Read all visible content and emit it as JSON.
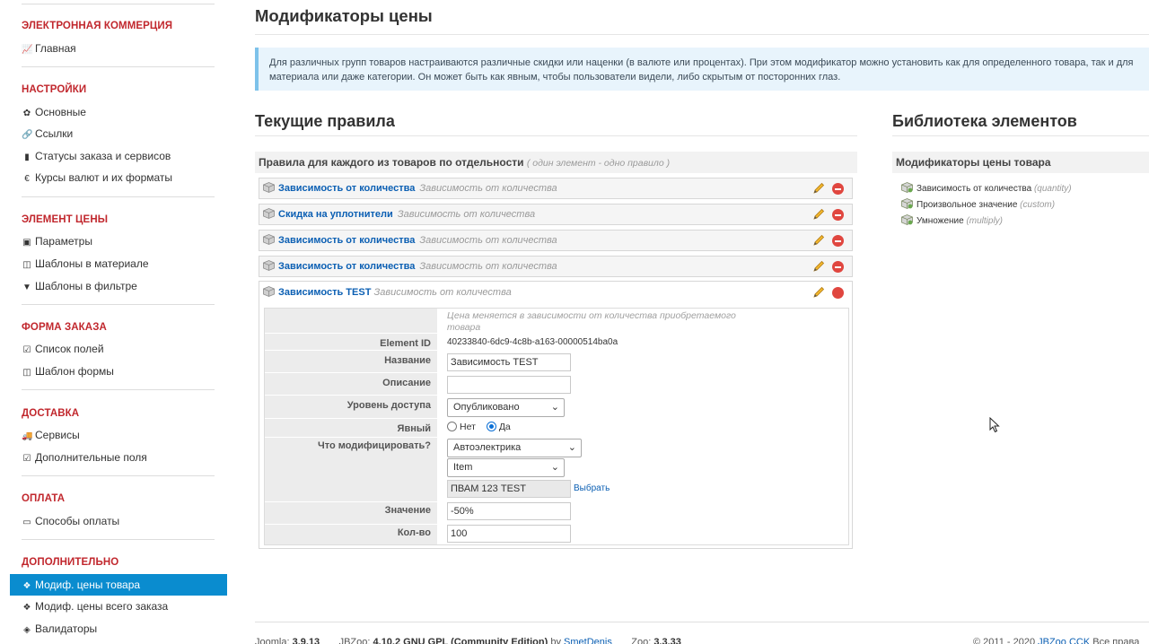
{
  "sidebar": {
    "sections": [
      {
        "title": "ЭЛЕКТРОННАЯ КОММЕРЦИЯ",
        "items": [
          {
            "label": "Главная",
            "icon": "chart-line-icon"
          }
        ]
      },
      {
        "title": "НАСТРОЙКИ",
        "items": [
          {
            "label": "Основные",
            "icon": "gear-icon"
          },
          {
            "label": "Ссылки",
            "icon": "link-icon"
          },
          {
            "label": "Статусы заказа и сервисов",
            "icon": "bookmark-icon"
          },
          {
            "label": "Курсы валют и их форматы",
            "icon": "euro-icon"
          }
        ]
      },
      {
        "title": "ЭЛЕМЕНТ ЦЕНЫ",
        "items": [
          {
            "label": "Параметры",
            "icon": "money-icon"
          },
          {
            "label": "Шаблоны в материале",
            "icon": "columns-icon"
          },
          {
            "label": "Шаблоны в фильтре",
            "icon": "filter-icon"
          }
        ]
      },
      {
        "title": "ФОРМА ЗАКАЗА",
        "items": [
          {
            "label": "Список полей",
            "icon": "checkbox-icon"
          },
          {
            "label": "Шаблон формы",
            "icon": "columns-icon"
          }
        ]
      },
      {
        "title": "ДОСТАВКА",
        "items": [
          {
            "label": "Сервисы",
            "icon": "truck-icon"
          },
          {
            "label": "Дополнительные поля",
            "icon": "checkbox-icon"
          }
        ]
      },
      {
        "title": "ОПЛАТА",
        "items": [
          {
            "label": "Способы оплаты",
            "icon": "credit-card-icon"
          }
        ]
      },
      {
        "title": "ДОПОЛНИТЕЛЬНО",
        "items": [
          {
            "label": "Модиф. цены товара",
            "icon": "cubes-icon",
            "active": true
          },
          {
            "label": "Модиф. цены всего заказа",
            "icon": "cubes-icon"
          },
          {
            "label": "Валидаторы",
            "icon": "cube-icon"
          }
        ]
      }
    ]
  },
  "page": {
    "title": "Модификаторы цены",
    "info_line1": "Для различных групп товаров настраиваются различные скидки или наценки (в валюте или процентах). При этом модификатор можно установить как для определенного товара, так и для",
    "info_line2": "материала или даже категории. Он может быть как явным, чтобы пользователи видели, либо скрытым от посторонних глаз."
  },
  "current_rules": {
    "heading": "Текущие правила",
    "bar_title": "Правила для каждого из товаров по отдельности",
    "bar_note": "( один элемент - одно правило )",
    "rules": [
      {
        "name": "Зависимость от количества",
        "desc": "Зависимость от количества"
      },
      {
        "name": "Скидка на уплотнители",
        "desc": "Зависимость от количества"
      },
      {
        "name": "Зависимость от количества",
        "desc": "Зависимость от количества"
      },
      {
        "name": "Зависимость от количества",
        "desc": "Зависимость от количества"
      }
    ],
    "open_rule": {
      "name": "Зависимость TEST",
      "desc": "Зависимость от количества",
      "help_line1": "Цена меняется в зависимости от количества приобретаемого",
      "help_line2": "товара",
      "fields": {
        "element_id_label": "Element ID",
        "element_id_value": "40233840-6dc9-4c8b-a163-00000514ba0a",
        "name_label": "Название",
        "name_value": "Зависимость TEST",
        "desc_label": "Описание",
        "desc_value": "",
        "access_label": "Уровень доступа",
        "access_value": "Опубликовано",
        "explicit_label": "Явный",
        "explicit_no": "Нет",
        "explicit_yes": "Да",
        "modify_label": "Что модифицировать?",
        "modify_value": "Автоэлектрика",
        "modify_type": "Item",
        "modify_item": "ПВАМ 123 TEST",
        "choose_link": "Выбрать",
        "value_label": "Значение",
        "value_value": "-50%",
        "qty_label": "Кол-во",
        "qty_value": "100"
      }
    }
  },
  "library": {
    "heading": "Библиотека элементов",
    "bar_title": "Модификаторы цены товара",
    "items": [
      {
        "name": "Зависимость от количества",
        "code": "(quantity)"
      },
      {
        "name": "Произвольное значение",
        "code": "(custom)"
      },
      {
        "name": "Умножение",
        "code": "(multiply)"
      }
    ]
  },
  "footer": {
    "joomla_label": "Joomla:",
    "joomla_ver": "3.9.13",
    "jbzoo_label": "JBZoo:",
    "jbzoo_ver": "4.10.2 GNU GPL (Community Edition)",
    "jbzoo_by": "by",
    "jbzoo_author": "SmetDenis",
    "zoo_label": "Zoo:",
    "zoo_ver": "3.3.33",
    "copyright": "© 2011 - 2020",
    "copyright_link": "JBZoo CCK",
    "copyright_tail": "Все права"
  },
  "colors": {
    "section_red": "#c1272d",
    "active_blue": "#0a8ccf",
    "link_blue": "#0b5fb3",
    "info_bg": "#e8f4fc",
    "info_border": "#7dc2ea"
  }
}
